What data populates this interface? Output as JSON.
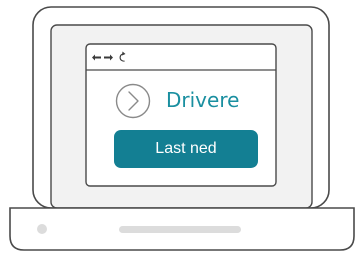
{
  "browser": {
    "product_label": "Drivere",
    "download_button_label": "Last ned",
    "icons": [
      "back-arrow-icon",
      "forward-arrow-icon",
      "reload-icon",
      "chevron-right-circle-icon"
    ]
  },
  "colors": {
    "outline": "#4a4a4a",
    "accent_text": "#1a8fa0",
    "button_fill": "#137f93",
    "button_text": "#ffffff",
    "screen_bezel": "#f2f2f2",
    "detail_grey": "#dcdcdc"
  }
}
